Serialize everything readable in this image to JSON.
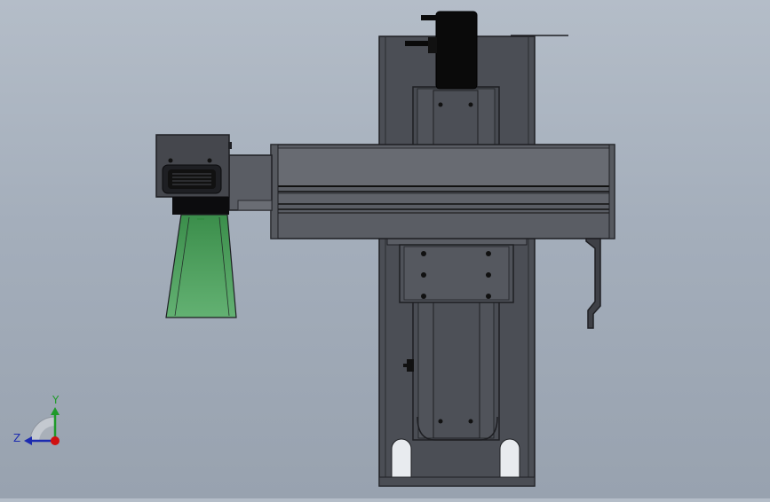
{
  "triad": {
    "y_label": "Y",
    "z_label": "Z",
    "colors": {
      "y": "#1f9a2a",
      "z": "#1c2bb0",
      "x": "#d01010"
    }
  },
  "model": {
    "colors": {
      "plate": "#4b4e55",
      "plate_edge": "#1e1f23",
      "beam": "#5a5d64",
      "head": "#45474d",
      "beam_light": "#686b72",
      "motor": "#0a0a0a",
      "beam_cone": "#3fa34f"
    }
  }
}
